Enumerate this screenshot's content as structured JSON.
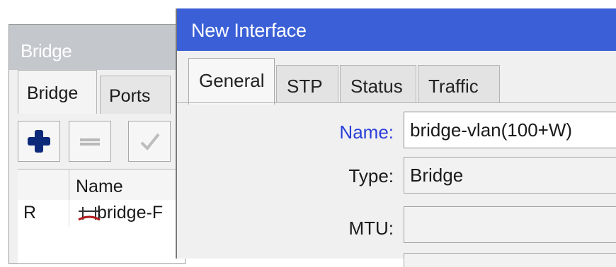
{
  "bridge_window": {
    "title": "Bridge",
    "tabs": [
      "Bridge",
      "Ports"
    ],
    "toolbar": {
      "add_icon": "plus-icon",
      "remove_icon": "minus-icon",
      "enable_icon": "check-icon"
    },
    "list": {
      "column_name": "Name",
      "rows": [
        {
          "flag": "R",
          "name": "bridge-F",
          "icon": "bridge-icon"
        }
      ]
    }
  },
  "dialog": {
    "title": "New Interface",
    "tabs": [
      "General",
      "STP",
      "Status",
      "Traffic"
    ],
    "active_tab": "General",
    "fields": {
      "name": {
        "label": "Name:",
        "value": "bridge-vlan(100+W)"
      },
      "type": {
        "label": "Type:",
        "value": "Bridge"
      },
      "mtu": {
        "label": "MTU:",
        "value": ""
      }
    }
  },
  "colors": {
    "titlebar_active": "#3a5fd6",
    "titlebar_inactive": "#c4c7cc",
    "name_label": "#2a3fd9",
    "add_icon": "#0d2a7a",
    "bridge_icon_accent": "#b21818"
  }
}
